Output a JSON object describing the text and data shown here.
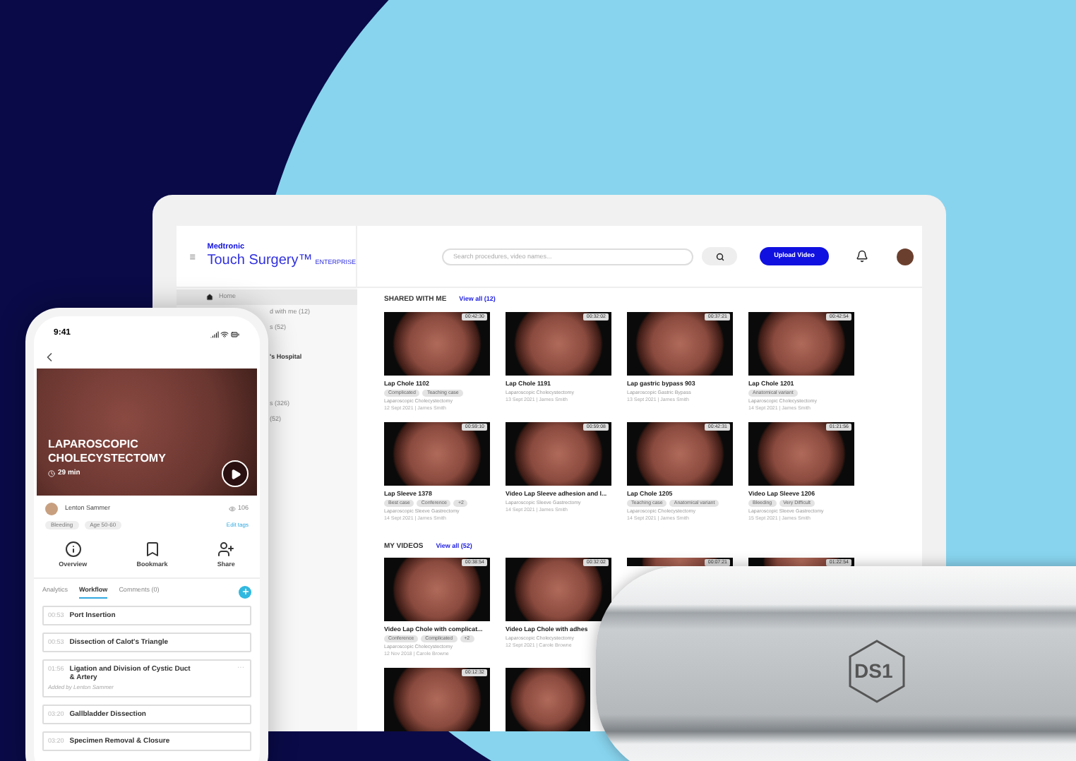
{
  "laptop": {
    "brand": "Medtronic",
    "product": "Touch Surgery™",
    "edition": "ENTERPRISE",
    "search": {
      "placeholder": "Search procedures, video names..."
    },
    "upload_button": "Upload Video",
    "sidebar": {
      "items": [
        {
          "label": "Home",
          "kind": "home",
          "selected": true
        },
        {
          "label": "d with me (12)",
          "kind": "item",
          "selected": false
        },
        {
          "label": "s (52)",
          "kind": "item",
          "selected": false
        },
        {
          "label": "'s Hospital",
          "kind": "heading",
          "selected": false
        },
        {
          "label": "s (326)",
          "kind": "item",
          "selected": false
        },
        {
          "label": "(52)",
          "kind": "item",
          "selected": false
        }
      ]
    },
    "sections": [
      {
        "title": "SHARED WITH ME",
        "link": "View all (12)",
        "videos": [
          {
            "kind": "full",
            "duration": "00:42:30",
            "title": "Lap Chole 1102",
            "tags": [
              "Complicated",
              "Teaching case"
            ],
            "procedure": "Laparoscopic Cholecystectomy",
            "date": "12 Sept 2021 | James Smith"
          },
          {
            "kind": "full",
            "duration": "00:32:02",
            "title": "Lap Chole 1191",
            "procedure": "Laparoscopic Cholecystectomy",
            "date": "13 Sept 2021 | James Smith"
          },
          {
            "kind": "full",
            "duration": "00:37:21",
            "title": "Lap gastric bypass 903",
            "procedure": "Laparoscopic Gastric Bypass",
            "date": "13 Sept 2021 | James Smith"
          },
          {
            "kind": "full",
            "duration": "00:42:54",
            "title": "Lap Chole 1201",
            "tags": [
              "Anatomical variant"
            ],
            "procedure": "Laparoscopic Cholecystectomy",
            "date": "14 Sept 2021 | James Smith"
          },
          {
            "kind": "full",
            "duration": "00:59:10",
            "title": "Lap Sleeve 1378",
            "tags": [
              "Best case",
              "Conference",
              "+2"
            ],
            "procedure": "Laparoscopic Sleeve Gastrectomy",
            "date": "14 Sept 2021 | James Smith"
          },
          {
            "kind": "full",
            "duration": "00:59:08",
            "title": "Video Lap Sleeve adhesion and l...",
            "procedure": "Laparoscopic Sleeve Gastrectomy",
            "date": "14 Sept 2021 | James Smith"
          },
          {
            "kind": "full",
            "duration": "00:42:31",
            "title": "Lap Chole 1205",
            "tags": [
              "Teaching case",
              "Anatomical variant"
            ],
            "procedure": "Laparoscopic Cholecystectomy",
            "date": "14 Sept 2021 | James Smith"
          },
          {
            "kind": "full",
            "duration": "01:21:56",
            "title": "Video Lap Sleeve 1206",
            "tags": [
              "Bleeding",
              "Very Difficult"
            ],
            "procedure": "Laparoscopic Sleeve Gastrectomy",
            "date": "15 Sept 2021 | James Smith"
          }
        ]
      },
      {
        "title": "MY VIDEOS",
        "link": "View all (52)",
        "videos": [
          {
            "kind": "full",
            "duration": "00:38:54",
            "title": "Video Lap Chole with complicat...",
            "tags": [
              "Conference",
              "Complicated",
              "+2"
            ],
            "procedure": "Laparoscopic Cholecystectomy",
            "date": "12 Nov 2018 | Carole Browne"
          },
          {
            "kind": "full",
            "duration": "00:32:02",
            "title": "Video Lap Chole with adhes",
            "procedure": "Laparoscopic Cholecystectomy",
            "date": "12 Sept 2021 | Carole Browne"
          },
          {
            "kind": "covered",
            "duration": "00:07:21"
          },
          {
            "kind": "covered",
            "duration": "01:22:54"
          },
          {
            "kind": "full",
            "duration": "00:12:32"
          },
          {
            "kind": "thumbnail"
          }
        ]
      }
    ]
  },
  "phone": {
    "time": "9:41",
    "video": {
      "title": "LAPAROSCOPIC CHOLECYSTECTOMY",
      "duration": "29 min"
    },
    "author": "Lenton Sammer",
    "views": "106",
    "tags": [
      "Bleeding",
      "Age 50-60"
    ],
    "edit_tags": "Edit tags",
    "actions": [
      {
        "label": "Overview",
        "kind": "info"
      },
      {
        "label": "Bookmark",
        "kind": "bookmark"
      },
      {
        "label": "Share",
        "kind": "share"
      }
    ],
    "tabs": [
      {
        "label": "Analytics",
        "selected": false
      },
      {
        "label": "Workflow",
        "selected": true
      },
      {
        "label": "Comments (0)",
        "selected": false
      }
    ],
    "steps": [
      {
        "time": "00:53",
        "title": "Port Insertion"
      },
      {
        "time": "00:53",
        "title": "Dissection of Calot's Triangle"
      },
      {
        "time": "01:56",
        "title": "Ligation and Division of Cystic Duct & Artery",
        "note": "Added by Lenton Sammer",
        "menu": "···"
      },
      {
        "time": "03:20",
        "title": "Gallbladder Dissection"
      },
      {
        "time": "03:20",
        "title": "Specimen Removal & Closure"
      }
    ]
  },
  "device": {
    "label": "DS1"
  }
}
